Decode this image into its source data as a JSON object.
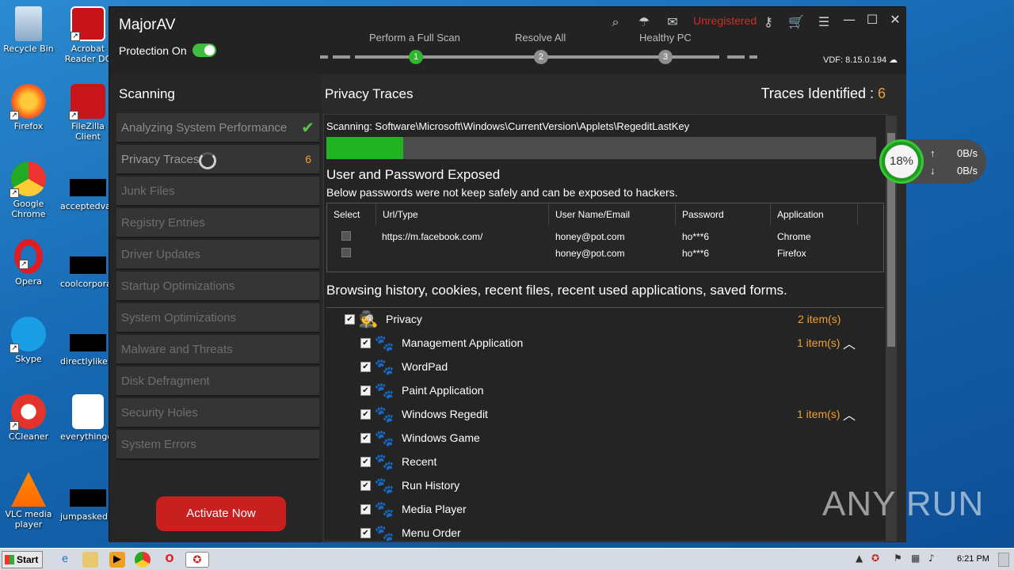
{
  "desktop": {
    "icons": [
      {
        "label": "Recycle Bin"
      },
      {
        "label": "Acrobat Reader DC"
      },
      {
        "label": "Firefox"
      },
      {
        "label": "FileZilla Client"
      },
      {
        "label": "Google Chrome"
      },
      {
        "label": "acceptedva..."
      },
      {
        "label": "Opera"
      },
      {
        "label": "coolcorpora..."
      },
      {
        "label": "Skype"
      },
      {
        "label": "directlylike.jp"
      },
      {
        "label": "CCleaner"
      },
      {
        "label": "everythingd..."
      },
      {
        "label": "VLC media player"
      },
      {
        "label": "jumpasked..."
      }
    ]
  },
  "app": {
    "title": "MajorAV",
    "protection_label": "Protection On",
    "steps": [
      "Perform a Full Scan",
      "Resolve All",
      "Healthy PC"
    ],
    "step_numbers": [
      "1",
      "2",
      "3"
    ],
    "unregistered": "Unregistered",
    "vdf": "VDF: 8.15.0.194",
    "sidebar": {
      "heading": "Scanning",
      "items": [
        {
          "label": "Analyzing System Performance"
        },
        {
          "label": "Privacy Traces",
          "count": "6"
        },
        {
          "label": "Junk Files"
        },
        {
          "label": "Registry Entries"
        },
        {
          "label": "Driver Updates"
        },
        {
          "label": "Startup Optimizations"
        },
        {
          "label": "System Optimizations"
        },
        {
          "label": "Malware and Threats"
        },
        {
          "label": "Disk Defragment"
        },
        {
          "label": "Security Holes"
        },
        {
          "label": "System Errors"
        }
      ],
      "activate_label": "Activate Now"
    },
    "main": {
      "title": "Privacy Traces",
      "traces_label": "Traces Identified : ",
      "traces_count": "6",
      "scanning_text": "Scanning: Software\\Microsoft\\Windows\\CurrentVersion\\Applets\\RegeditLastKey",
      "progress": 0.14,
      "section1_title": "User and Password Exposed",
      "section1_subtitle": "Below passwords were not keep safely and can be exposed to hackers.",
      "table": {
        "headers": [
          "Select",
          "Url/Type",
          "User Name/Email",
          "Password",
          "Application"
        ],
        "rows": [
          [
            "",
            "https://m.facebook.com/",
            "honey@pot.com",
            "ho***6",
            "Chrome"
          ],
          [
            "",
            "",
            "honey@pot.com",
            "ho***6",
            "Firefox"
          ]
        ]
      },
      "section2_title": "Browsing history, cookies, recent files, recent used applications, saved forms.",
      "tree": [
        {
          "label": "Privacy",
          "count": "2 item(s)",
          "level": 0
        },
        {
          "label": "Management Application",
          "count": "1 item(s)",
          "level": 1,
          "caret": true
        },
        {
          "label": "WordPad",
          "count": "",
          "level": 1
        },
        {
          "label": "Paint Application",
          "count": "",
          "level": 1
        },
        {
          "label": "Windows Regedit",
          "count": "1 item(s)",
          "level": 1,
          "caret": true
        },
        {
          "label": "Windows Game",
          "count": "",
          "level": 1
        },
        {
          "label": "Recent",
          "count": "",
          "level": 1
        },
        {
          "label": "Run History",
          "count": "",
          "level": 1
        },
        {
          "label": "Media Player",
          "count": "",
          "level": 1
        },
        {
          "label": "Menu Order",
          "count": "",
          "level": 1
        }
      ]
    }
  },
  "speed_widget": {
    "percent": "18%",
    "up_arrow": "↑",
    "down_arrow": "↓",
    "upload": "0B/s",
    "download": "0B/s"
  },
  "watermark": "ANY RUN",
  "taskbar": {
    "start_label": "Start",
    "clock": "6:21 PM"
  },
  "colors": {
    "accent_green": "#22b322",
    "warning_orange": "#f0a030",
    "danger_red": "#c8201e"
  }
}
